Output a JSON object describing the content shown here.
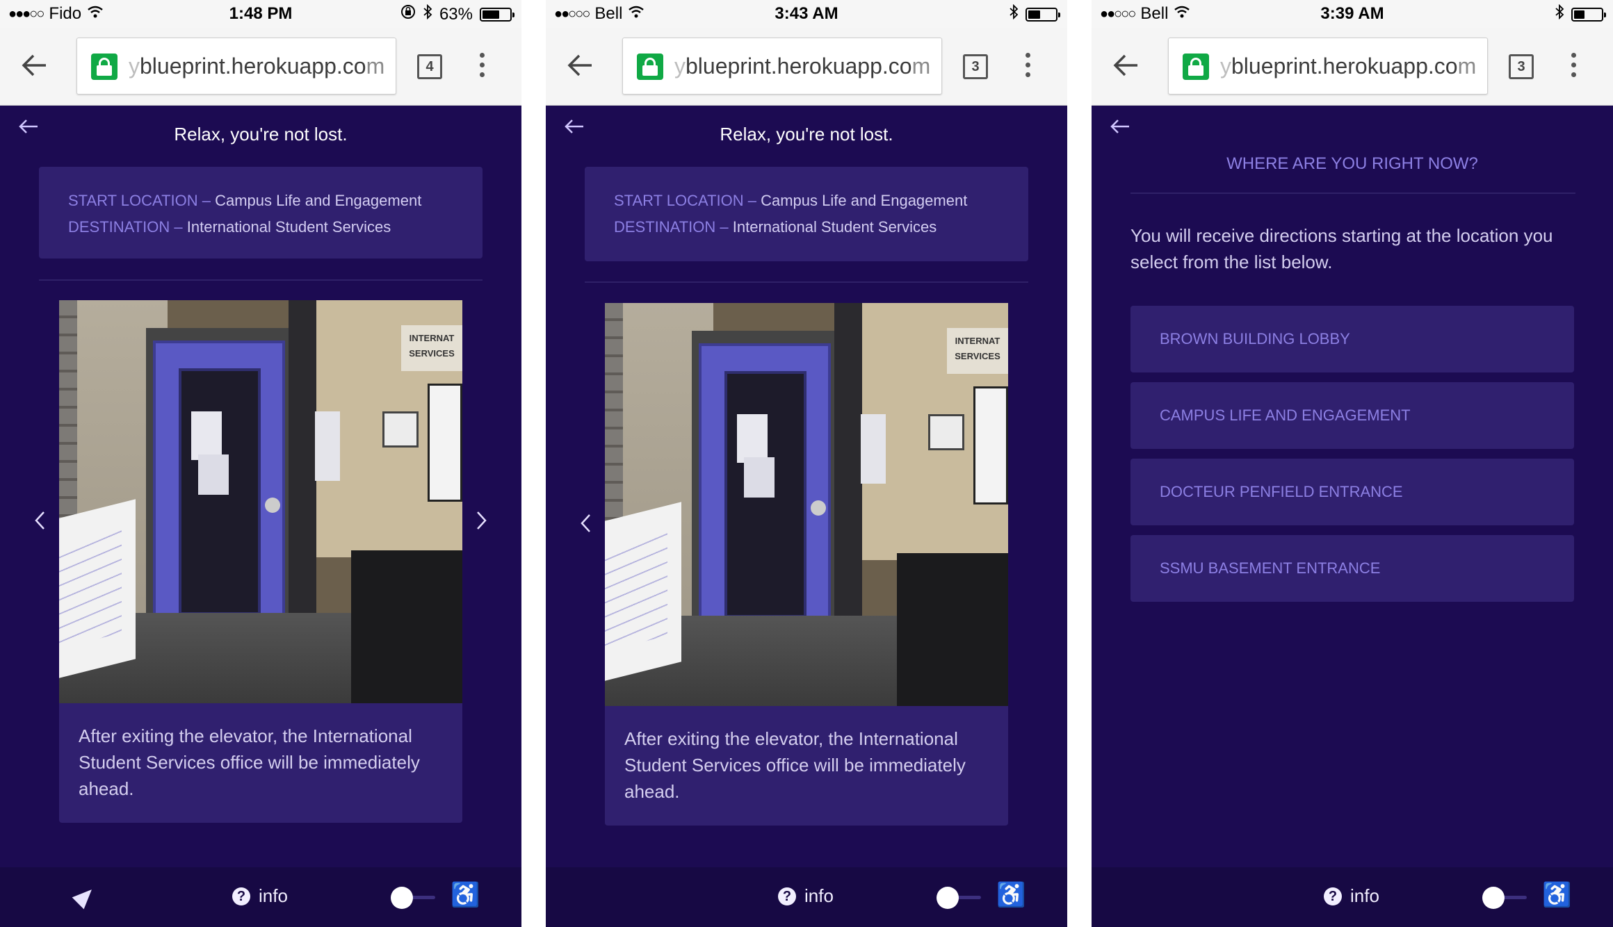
{
  "screens": [
    {
      "status": {
        "carrier": "Fido",
        "time": "1:48 PM",
        "battery_label": "63%",
        "battery_level": 0.63
      },
      "browser": {
        "url_fade": "y",
        "url_main": "blueprint.herokuapp.co",
        "url_tail": "m",
        "tab_count": "4"
      },
      "app": {
        "title": "Relax, you're not lost.",
        "start_label": "START LOCATION –",
        "start_value": "Campus Life and Engagement",
        "dest_label": "DESTINATION –",
        "dest_value": "International Student Services",
        "sign_line1": "INTERNAT",
        "sign_line2": "SERVICES",
        "caption": "After exiting the elevator, the International Student Services office will be immediately ahead."
      },
      "bottom": {
        "info_label": "info"
      }
    },
    {
      "status": {
        "carrier": "Bell",
        "time": "3:43 AM",
        "battery_level": 0.45
      },
      "browser": {
        "url_fade": "y",
        "url_main": "blueprint.herokuapp.co",
        "url_tail": "m",
        "tab_count": "3"
      },
      "app": {
        "title": "Relax, you're not lost.",
        "start_label": "START LOCATION –",
        "start_value": "Campus Life and Engagement",
        "dest_label": "DESTINATION –",
        "dest_value": "International Student Services",
        "sign_line1": "INTERNAT",
        "sign_line2": "SERVICES",
        "caption": "After exiting the elevator, the International Student Services office will be immediately ahead."
      },
      "bottom": {
        "info_label": "info"
      }
    },
    {
      "status": {
        "carrier": "Bell",
        "time": "3:39 AM",
        "battery_level": 0.4
      },
      "browser": {
        "url_fade": "y",
        "url_main": "blueprint.herokuapp.co",
        "url_tail": "m",
        "tab_count": "3"
      },
      "app": {
        "heading": "WHERE ARE YOU RIGHT NOW?",
        "description": "You will receive directions starting at the location you select from the list below.",
        "locations": [
          "BROWN BUILDING LOBBY",
          "CAMPUS LIFE AND ENGAGEMENT",
          "DOCTEUR PENFIELD ENTRANCE",
          "SSMU BASEMENT ENTRANCE"
        ]
      },
      "bottom": {
        "info_label": "info"
      }
    }
  ],
  "icons": {
    "signal": "signal-dots-icon",
    "wifi": "wifi-icon",
    "bluetooth": "bluetooth-icon",
    "lock": "secure-lock-icon",
    "back": "back-arrow-icon",
    "menu": "kebab-menu-icon",
    "prev": "chevron-left-icon",
    "next": "chevron-right-icon",
    "locate": "location-arrow-icon",
    "info": "question-circle-icon",
    "wheelchair": "wheelchair-icon"
  },
  "colors": {
    "app_bg": "#1c0b52",
    "card_bg": "#30206f",
    "accent": "#8d80e4",
    "bottom_bar": "#170944",
    "secure_green": "#10a945"
  }
}
